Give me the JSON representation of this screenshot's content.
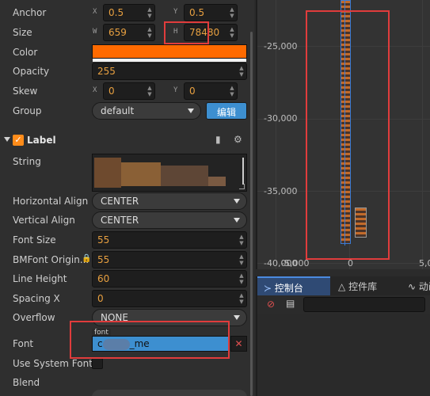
{
  "inspector": {
    "anchor": {
      "label": "Anchor",
      "x_axis": "X",
      "x": "0.5",
      "y_axis": "Y",
      "y": "0.5"
    },
    "size": {
      "label": "Size",
      "w_axis": "W",
      "w": "659",
      "h_axis": "H",
      "h": "78480"
    },
    "color": {
      "label": "Color",
      "value": "#ff6a00"
    },
    "opacity": {
      "label": "Opacity",
      "value": "255"
    },
    "skew": {
      "label": "Skew",
      "x_axis": "X",
      "x": "0",
      "y_axis": "Y",
      "y": "0"
    },
    "group": {
      "label": "Group",
      "value": "default",
      "edit_button": "编辑"
    },
    "label_component": {
      "title": "Label",
      "enabled": true,
      "string": {
        "label": "String"
      },
      "horizontal_align": {
        "label": "Horizontal Align",
        "value": "CENTER"
      },
      "vertical_align": {
        "label": "Vertical Align",
        "value": "CENTER"
      },
      "font_size": {
        "label": "Font Size",
        "value": "55"
      },
      "bmfont_origin": {
        "label": "BMFont Origin..."
      },
      "bmfont_value": "55",
      "line_height": {
        "label": "Line Height",
        "value": "60"
      },
      "spacing_x": {
        "label": "Spacing X",
        "value": "0"
      },
      "overflow": {
        "label": "Overflow",
        "value": "NONE"
      },
      "font": {
        "label": "Font",
        "tag": "font",
        "value_prefix": "c",
        "value_suffix": "_me"
      },
      "use_system_font": {
        "label": "Use System Font",
        "checked": false
      },
      "blend": {
        "label": "Blend"
      }
    }
  },
  "scene": {
    "y_labels": [
      "-25,000",
      "-30,000",
      "-35,000",
      "-40,000"
    ],
    "x_labels": [
      "-5,000",
      "0",
      "5,00"
    ]
  },
  "console": {
    "tabs": [
      {
        "label": "控制台",
        "icon": "terminal-icon",
        "active": true
      },
      {
        "label": "控件库",
        "icon": "widget-icon",
        "active": false
      },
      {
        "label": "动画",
        "icon": "animation-icon",
        "active": false
      }
    ]
  },
  "colors": {
    "accent": "#3d8fd0",
    "orange": "#ff6a00",
    "highlight_box": "#e03c3c"
  }
}
